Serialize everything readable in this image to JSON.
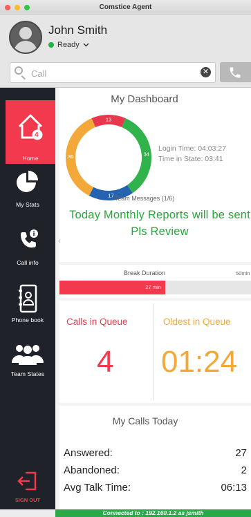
{
  "window": {
    "title": "Comstice Agent"
  },
  "user": {
    "name": "John Smith",
    "status": "Ready"
  },
  "search": {
    "placeholder": "Call",
    "value": ""
  },
  "sidebar": {
    "home": {
      "label": "Home",
      "badge": "4"
    },
    "items": [
      {
        "label": "My Stats",
        "icon": "pie-chart-icon"
      },
      {
        "label": "Call info",
        "icon": "phone-info-icon"
      },
      {
        "label": "Phone book",
        "icon": "phonebook-icon"
      },
      {
        "label": "Team States",
        "icon": "team-icon"
      }
    ],
    "signout": {
      "label": "SIGN OUT"
    }
  },
  "dashboard": {
    "title": "My Dashboard",
    "donut": [
      {
        "value": 13,
        "color": "#e8384d"
      },
      {
        "value": 34,
        "color": "#2fb34a"
      },
      {
        "value": 17,
        "color": "#2563b0"
      },
      {
        "value": 36,
        "color": "#f2a93a"
      }
    ],
    "login_time": "Login Time:  04:03:27",
    "time_in_state": "Time in State:   03:41"
  },
  "team_messages": {
    "title": "Team Messages (1/6)",
    "message": "Today Monthly Reports will be sent Pls Review"
  },
  "break_duration": {
    "title": "Break Duration",
    "max_label": "50min",
    "value_label": "27 min",
    "fraction": 0.54
  },
  "queue": {
    "calls_label": "Calls in Queue",
    "calls_value": "4",
    "calls_color": "#f2394d",
    "oldest_label": "Oldest in Queue",
    "oldest_value": "01:24",
    "oldest_color": "#f2a93a"
  },
  "calls_today": {
    "title": "My Calls Today",
    "rows": [
      {
        "label": "Answered:",
        "value": "27"
      },
      {
        "label": "Abandoned:",
        "value": "2"
      },
      {
        "label": "Avg Talk Time:",
        "value": "06:13"
      }
    ]
  },
  "connection": {
    "text": "Connected to : 192.160.1.2 as jsmith"
  }
}
